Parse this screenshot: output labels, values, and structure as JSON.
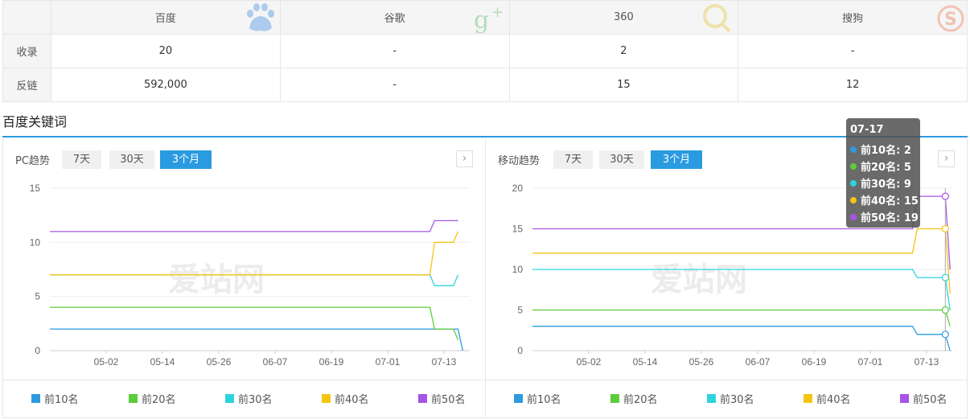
{
  "stats": {
    "engines": [
      "百度",
      "谷歌",
      "360",
      "搜狗"
    ],
    "rows": [
      {
        "label": "收录",
        "values": [
          "20",
          "-",
          "2",
          "-"
        ]
      },
      {
        "label": "反链",
        "values": [
          "592,000",
          "-",
          "15",
          "12"
        ]
      }
    ]
  },
  "section_title": "百度关键词",
  "watermark": "爱站网",
  "range_buttons": [
    "7天",
    "30天",
    "3个月"
  ],
  "active_range": "3个月",
  "colors": {
    "top10": "#2e9be0",
    "top20": "#5ccc3c",
    "top30": "#2ed3dc",
    "top40": "#f5c515",
    "top50": "#a654e6",
    "accent": "#2a9be0"
  },
  "tooltip": {
    "date": "07-17",
    "rows": [
      {
        "label": "前10名: 2",
        "color": "#2e9be0"
      },
      {
        "label": "前20名: 5",
        "color": "#5ccc3c"
      },
      {
        "label": "前30名: 9",
        "color": "#2ed3dc"
      },
      {
        "label": "前40名: 15",
        "color": "#f5c515"
      },
      {
        "label": "前50名: 19",
        "color": "#a654e6"
      }
    ]
  },
  "chart_data": [
    {
      "type": "line",
      "title": "PC趋势",
      "x_ticks": [
        "05-02",
        "05-14",
        "05-26",
        "06-07",
        "06-19",
        "07-01",
        "07-13"
      ],
      "ylim": [
        0,
        15
      ],
      "y_ticks": [
        "0",
        "5",
        "10",
        "15"
      ],
      "legend": [
        "前10名",
        "前20名",
        "前30名",
        "前40名",
        "前50名"
      ],
      "series": [
        {
          "name": "前10名",
          "points": [
            [
              "04-20",
              2
            ],
            [
              "07-10",
              2
            ],
            [
              "07-16",
              2
            ],
            [
              "07-17",
              0
            ]
          ]
        },
        {
          "name": "前20名",
          "points": [
            [
              "04-20",
              4
            ],
            [
              "07-10",
              4
            ],
            [
              "07-11",
              2
            ],
            [
              "07-15",
              2
            ],
            [
              "07-16",
              1
            ]
          ]
        },
        {
          "name": "前30名",
          "points": [
            [
              "04-20",
              7
            ],
            [
              "07-10",
              7
            ],
            [
              "07-11",
              6
            ],
            [
              "07-15",
              6
            ],
            [
              "07-16",
              7
            ]
          ]
        },
        {
          "name": "前40名",
          "points": [
            [
              "04-20",
              7
            ],
            [
              "07-10",
              7
            ],
            [
              "07-11",
              10
            ],
            [
              "07-15",
              10
            ],
            [
              "07-16",
              11
            ]
          ]
        },
        {
          "name": "前50名",
          "points": [
            [
              "04-20",
              11
            ],
            [
              "07-10",
              11
            ],
            [
              "07-11",
              12
            ],
            [
              "07-16",
              12
            ]
          ]
        }
      ]
    },
    {
      "type": "line",
      "title": "移动趋势",
      "x_ticks": [
        "05-02",
        "05-14",
        "05-26",
        "06-07",
        "06-19",
        "07-01",
        "07-13"
      ],
      "ylim": [
        0,
        20
      ],
      "y_ticks": [
        "0",
        "5",
        "10",
        "15",
        "20"
      ],
      "legend": [
        "前10名",
        "前20名",
        "前30名",
        "前40名",
        "前50名"
      ],
      "series": [
        {
          "name": "前10名",
          "points": [
            [
              "04-20",
              3
            ],
            [
              "07-10",
              3
            ],
            [
              "07-11",
              2
            ],
            [
              "07-17",
              2
            ],
            [
              "07-18",
              0
            ]
          ]
        },
        {
          "name": "前20名",
          "points": [
            [
              "04-20",
              5
            ],
            [
              "07-17",
              5
            ],
            [
              "07-18",
              3
            ]
          ]
        },
        {
          "name": "前30名",
          "points": [
            [
              "04-20",
              10
            ],
            [
              "07-10",
              10
            ],
            [
              "07-11",
              9
            ],
            [
              "07-17",
              9
            ],
            [
              "07-18",
              5
            ]
          ]
        },
        {
          "name": "前40名",
          "points": [
            [
              "04-20",
              12
            ],
            [
              "07-10",
              12
            ],
            [
              "07-11",
              15
            ],
            [
              "07-17",
              15
            ],
            [
              "07-18",
              7
            ]
          ]
        },
        {
          "name": "前50名",
          "points": [
            [
              "04-20",
              15
            ],
            [
              "07-10",
              15
            ],
            [
              "07-11",
              19
            ],
            [
              "07-17",
              19
            ],
            [
              "07-18",
              10
            ]
          ]
        }
      ]
    }
  ]
}
